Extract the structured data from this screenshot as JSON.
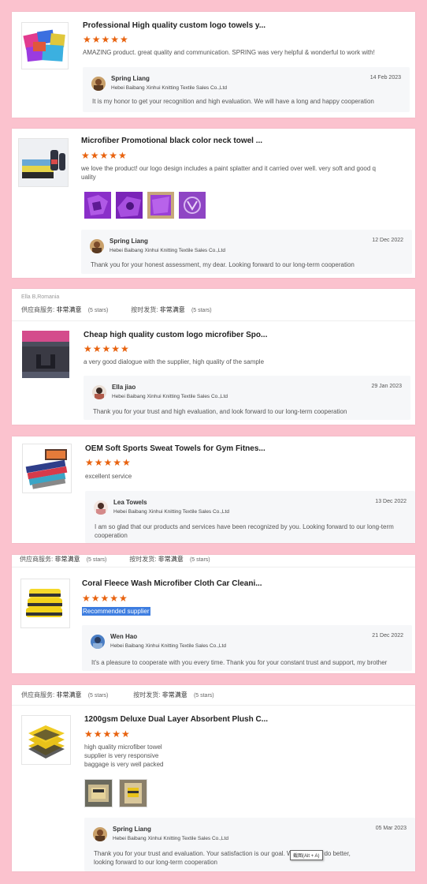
{
  "reviews": [
    {
      "meta": null,
      "title": "Professional High quality custom logo towels y...",
      "stars": "★★★★★",
      "text": [
        "AMAZING product. great quality and communication. SPRING was very helpful & wonderful to work with!"
      ],
      "highlighted": false,
      "photos": [],
      "reply": {
        "name": "Spring Liang",
        "company": "Hebei Baibang Xinhui Knitting Textile Sales Co.,Ltd",
        "date": "14 Feb 2023",
        "text": [
          "It is my honor to get your recognition and high evaluation. We will have a long and happy cooperation"
        ]
      }
    },
    {
      "meta": null,
      "title": "Microfiber Promotional black color neck towel ...",
      "stars": "★★★★★",
      "text": [
        "we love the product! our logo design includes a paint splatter and it carried over well.  very soft and good q",
        "uality"
      ],
      "highlighted": false,
      "photos": [
        "photo-1",
        "photo-2",
        "photo-3",
        "photo-4"
      ],
      "reply": {
        "name": "Spring Liang",
        "company": "Hebei Baibang Xinhui Knitting Textile Sales Co.,Ltd",
        "date": "12 Dec 2022",
        "text": [
          "Thank you for your honest assessment, my dear. Looking forward to our long-term cooperation"
        ]
      }
    },
    {
      "meta": {
        "reviewer": "Ella B,Romania",
        "supplier_label": "供应商服务:",
        "supplier_value": "非常满意",
        "supplier_stars": "(5 stars)",
        "shipping_label": "按时发货:",
        "shipping_value": "非常满意",
        "shipping_stars": "(5 stars)"
      },
      "title": "Cheap high quality custom logo microfiber Spo...",
      "stars": "★★★★★",
      "text": [
        "a very good dialogue with the supplier, high quality of the sample"
      ],
      "highlighted": false,
      "photos": [],
      "reply": {
        "name": "Ella jiao",
        "company": "Hebei Baibang Xinhui Knitting Textile Sales Co.,Ltd",
        "date": "29 Jan 2023",
        "text": [
          "Thank you for your trust and high evaluation, and look forward to our long-term cooperation"
        ]
      }
    },
    {
      "meta": null,
      "title": "OEM Soft Sports Sweat Towels for Gym Fitnes...",
      "stars": "★★★★★",
      "text": [
        "excellent service"
      ],
      "highlighted": false,
      "photos": [],
      "reply": {
        "name": "Lea Towels",
        "company": "Hebei Baibang Xinhui Knitting Textile Sales Co.,Ltd",
        "date": "13 Dec 2022",
        "text": [
          "I am so glad that our products and services have been recognized by you. Looking forward to our long-term",
          "cooperation"
        ]
      }
    },
    {
      "meta": {
        "reviewer": "",
        "supplier_label": "供应商服务:",
        "supplier_value": "非常满意",
        "supplier_stars": "(5 stars)",
        "shipping_label": "按时发货:",
        "shipping_value": "非常满意",
        "shipping_stars": "(5 stars)"
      },
      "title": "Coral Fleece Wash Microfiber Cloth Car Cleani...",
      "stars": "★★★★★",
      "text": [
        "Recommended supplier"
      ],
      "highlighted": true,
      "photos": [],
      "reply": {
        "name": "Wen Hao",
        "company": "Hebei Baibang Xinhui Knitting Textile Sales Co.,Ltd",
        "date": "21 Dec 2022",
        "text": [
          "It's a pleasure to cooperate with you every time. Thank you for your constant trust and support, my brother"
        ]
      }
    },
    {
      "meta": {
        "reviewer": "",
        "supplier_label": "供应商服务:",
        "supplier_value": "非常满意",
        "supplier_stars": "(5 stars)",
        "shipping_label": "按时发货:",
        "shipping_value": "非常满意",
        "shipping_stars": "(5 stars)"
      },
      "title": "1200gsm Deluxe Dual Layer Absorbent Plush C...",
      "stars": "★★★★★",
      "text": [
        "high quality microfiber towel",
        "supplier is very responsive",
        "baggage is very well packed"
      ],
      "highlighted": false,
      "photos": [
        "photo-1",
        "photo-2"
      ],
      "reply": {
        "name": "Spring Liang",
        "company": "Hebei Baibang Xinhui Knitting Textile Sales Co.,Ltd",
        "date": "05 Mar 2023",
        "text": [
          "Thank you for your trust and evaluation. Your satisfaction is our goal. We will try to do better,",
          "looking forward to our long-term cooperation"
        ]
      }
    }
  ],
  "tooltip": "截图(Alt + A)",
  "colors": {
    "background": "#fbc2ce",
    "stars": "#e8620e",
    "highlight": "#3d7de0"
  }
}
